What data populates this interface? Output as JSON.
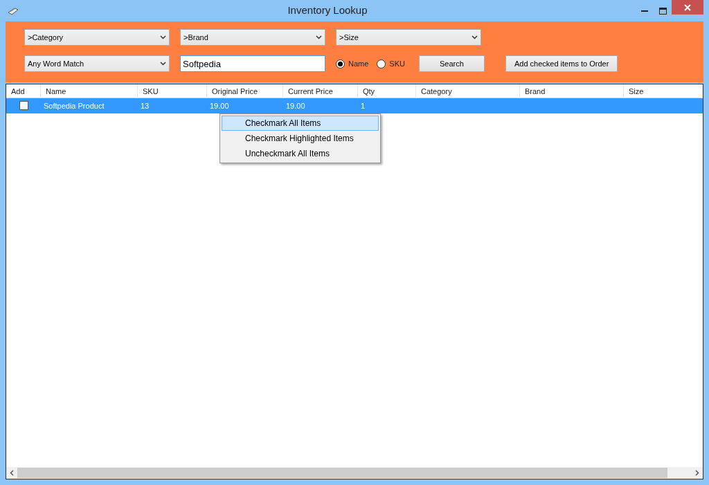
{
  "window": {
    "title": "Inventory Lookup"
  },
  "filters": [
    {
      "value": ">Category"
    },
    {
      "value": ">Brand"
    },
    {
      "value": ">Size"
    }
  ],
  "match_mode": {
    "value": "Any Word Match"
  },
  "search": {
    "value": "Softpedia"
  },
  "search_by": [
    {
      "label": "Name",
      "selected": true
    },
    {
      "label": "SKU",
      "selected": false
    }
  ],
  "buttons": [
    {
      "label": "Search"
    },
    {
      "label": "Add checked items to Order"
    }
  ],
  "table": {
    "columns": [
      "Add",
      "Name",
      "SKU",
      "Original Price",
      "Current Price",
      "Qty",
      "Category",
      "Brand",
      "Size"
    ],
    "rows": [
      {
        "checked": false,
        "selected": true,
        "cells": [
          "",
          "Softpedia Product",
          "13",
          "19.00",
          "19.00",
          "1",
          "",
          "",
          ""
        ]
      }
    ]
  },
  "context_menu": {
    "items": [
      {
        "label": "Checkmark All Items",
        "selected": true
      },
      {
        "label": "Checkmark Highlighted Items",
        "selected": false
      },
      {
        "label": "Uncheckmark All Items",
        "selected": false
      }
    ]
  }
}
